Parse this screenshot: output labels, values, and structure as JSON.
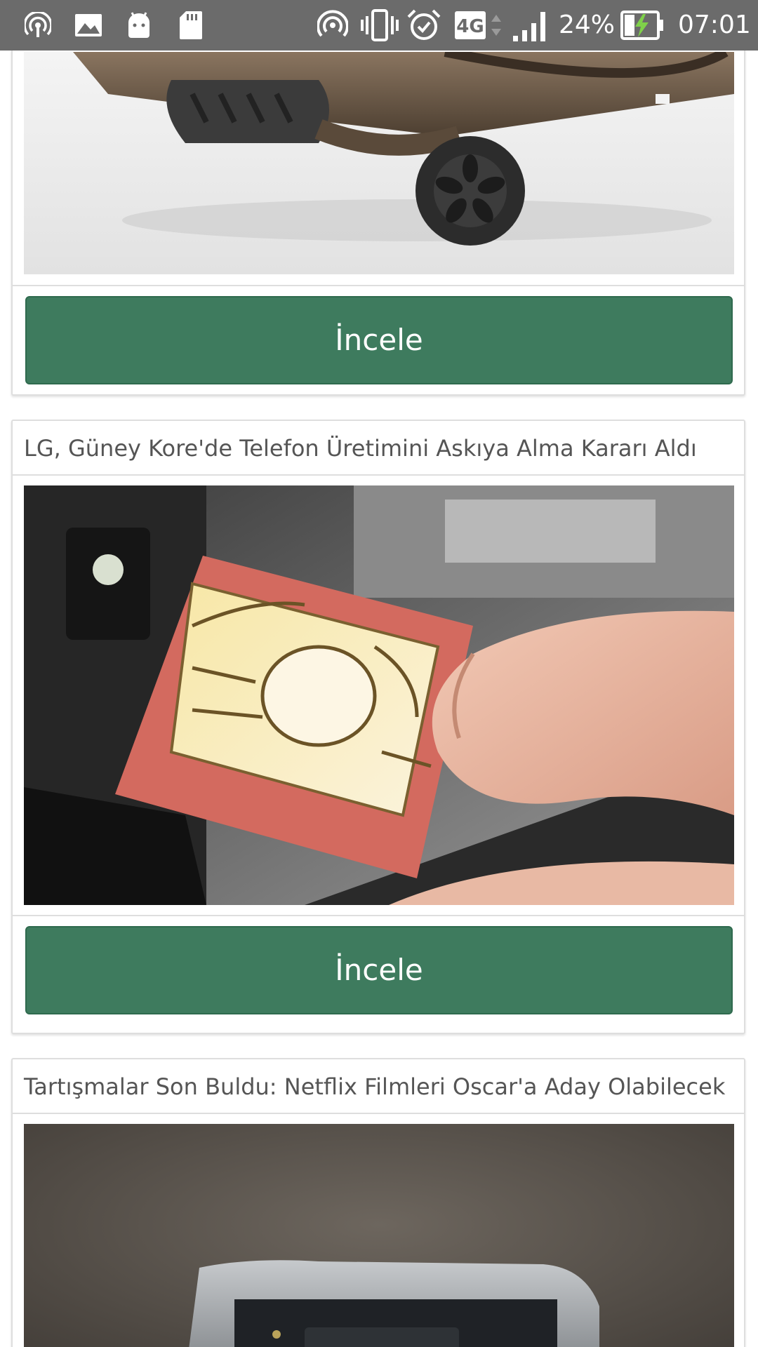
{
  "status_bar": {
    "battery": "24%",
    "time": "07:01",
    "network": "4G",
    "left_icons": [
      "hotspot-icon",
      "gallery-icon",
      "android-icon",
      "sd-card-icon"
    ],
    "right_icons": [
      "hotspot-icon",
      "vibrate-icon",
      "alarm-icon",
      "network-4g-icon",
      "signal-icon",
      "battery-charging-icon"
    ]
  },
  "feed": {
    "cards": [
      {
        "title": "",
        "image": "scooter-photo",
        "button_label": "İncele"
      },
      {
        "title": "LG, Güney Kore'de Telefon Üretimini Askıya Alma Kararı Aldı",
        "image": "sim-card-photo",
        "button_label": "İncele"
      },
      {
        "title": "Tartışmalar Son Buldu: Netflix Filmleri Oscar'a Aday Olabilecek",
        "image": "device-photo",
        "button_label": ""
      }
    ]
  },
  "colors": {
    "status_bar": "#6b6b6b",
    "button": "#3e7b5e",
    "title_text": "#555555",
    "border": "#dedede"
  }
}
